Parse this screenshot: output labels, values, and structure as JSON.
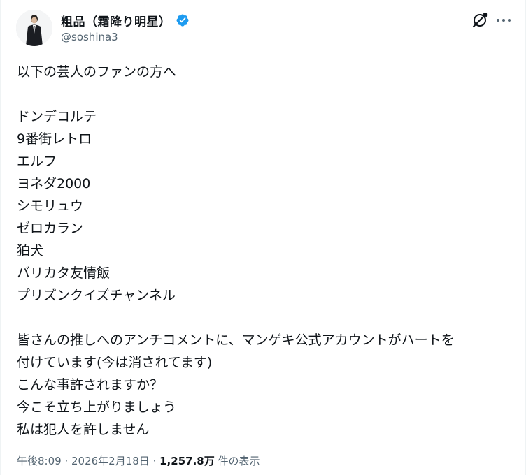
{
  "author": {
    "display_name": "粗品（霜降り明星）",
    "handle": "@soshina3",
    "verified_color": "#1d9bf0"
  },
  "tweet": {
    "intro": "以下の芸人のファンの方へ",
    "comedians": [
      "ドンデコルテ",
      "9番街レトロ",
      "エルフ",
      "ヨネダ2000",
      "シモリュウ",
      "ゼロカラン",
      "狛犬",
      "バリカタ友情飯",
      "プリズンクイズチャンネル"
    ],
    "body": [
      "皆さんの推しへのアンチコメントに、マンゲキ公式アカウントがハートを",
      "付けています(今は消されてます)",
      "こんな事許されますか？",
      "今こそ立ち上がりましょう",
      "私は犯人を許しません"
    ]
  },
  "meta": {
    "time": "午後8:09",
    "separator": " · ",
    "date": "2026年2月18日",
    "views_count": "1,257.8万",
    "views_label": " 件の表示"
  },
  "icons": {
    "grok": "grok-icon",
    "more": "more-icon",
    "verified": "verified-badge-icon"
  }
}
